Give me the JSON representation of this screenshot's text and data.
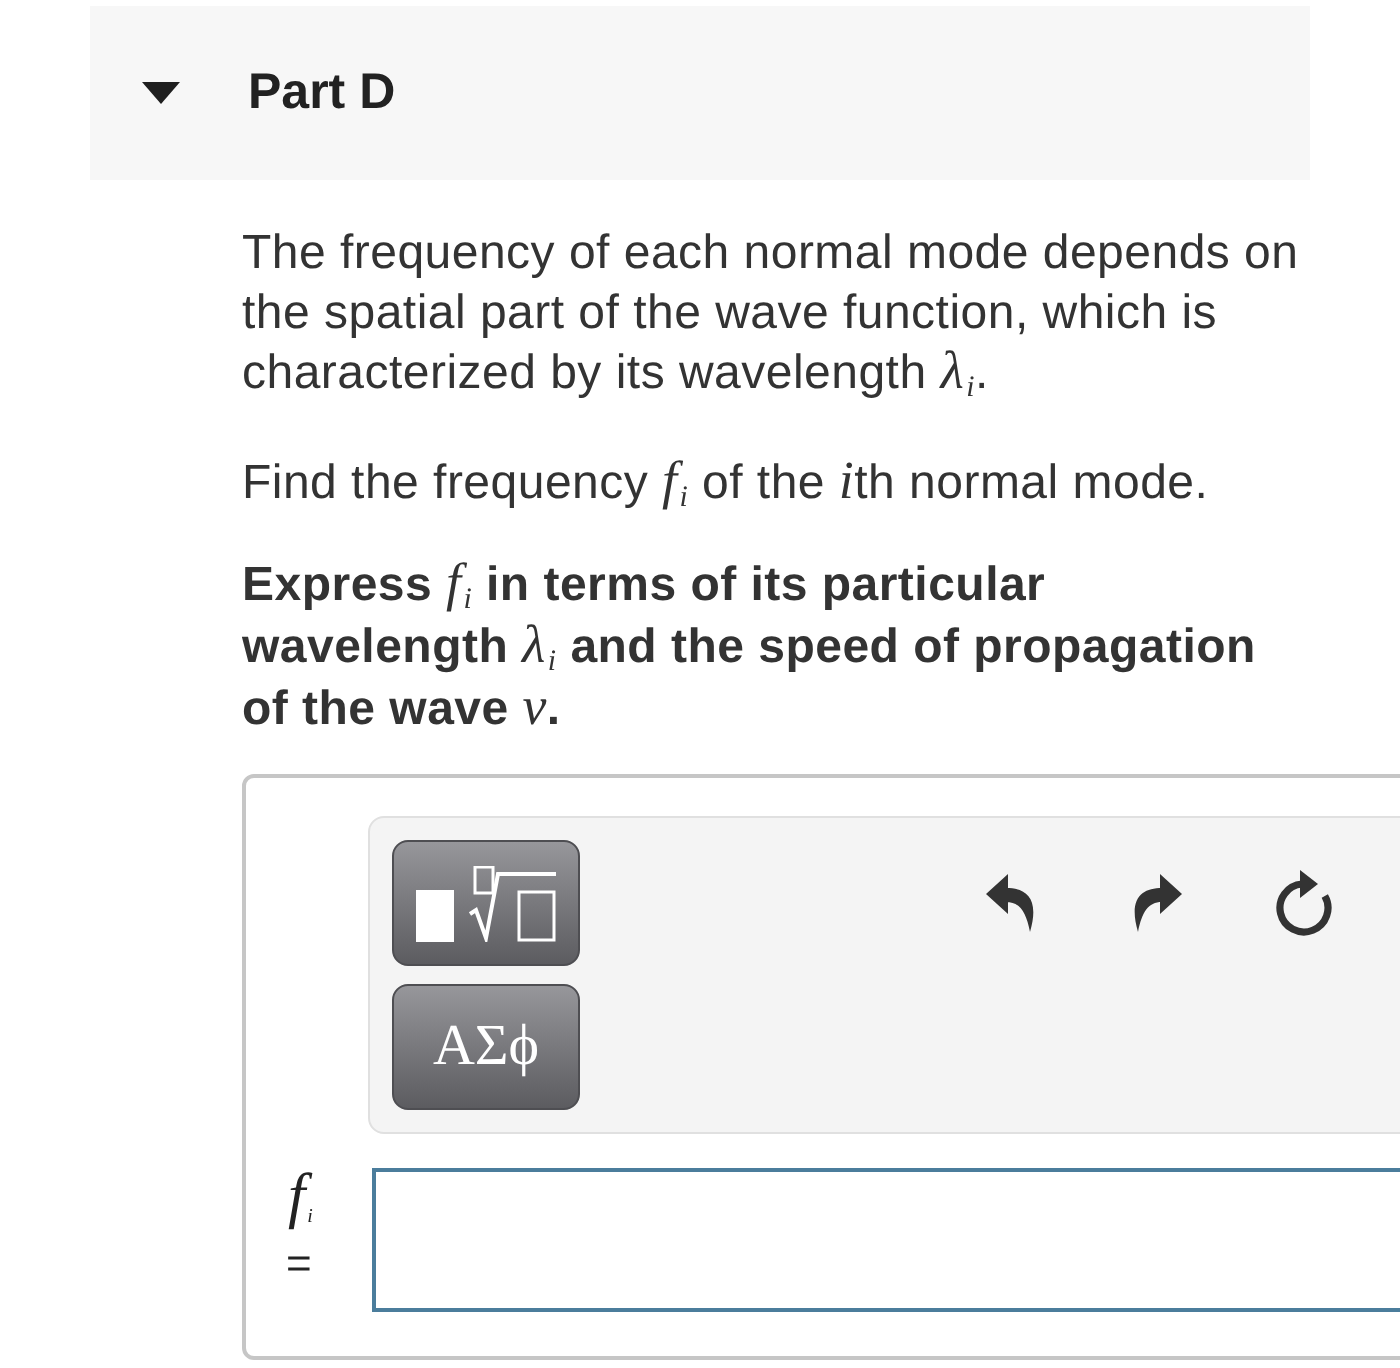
{
  "part": {
    "title": "Part D",
    "expanded": true
  },
  "question": [
    {
      "bold": false,
      "segments": [
        {
          "kind": "text",
          "text": "The frequency of each normal mode depends on the spatial part of the wave function, which is characterized by its wavelength "
        },
        {
          "kind": "math",
          "base": "λ",
          "sub": "i"
        },
        {
          "kind": "text",
          "text": "."
        }
      ]
    },
    {
      "bold": false,
      "segments": [
        {
          "kind": "text",
          "text": "Find the frequency "
        },
        {
          "kind": "math",
          "base": "f",
          "sub": "i"
        },
        {
          "kind": "text",
          "text": " of the "
        },
        {
          "kind": "math",
          "base": "i"
        },
        {
          "kind": "text",
          "text": "th normal mode."
        }
      ]
    },
    {
      "bold": true,
      "segments": [
        {
          "kind": "text",
          "text": "Express "
        },
        {
          "kind": "math",
          "base": "f",
          "sub": "i"
        },
        {
          "kind": "text",
          "text": " in terms of its particular wavelength "
        },
        {
          "kind": "math",
          "base": "λ",
          "sub": "i"
        },
        {
          "kind": "text",
          "text": " and the speed of propagation of the wave "
        },
        {
          "kind": "math",
          "base": "v"
        },
        {
          "kind": "text",
          "text": "."
        }
      ]
    }
  ],
  "answer": {
    "toolbar": {
      "palettes": [
        {
          "kind": "templates"
        },
        {
          "kind": "symbols",
          "label": "ΑΣϕ"
        }
      ],
      "actions": [
        {
          "kind": "undo"
        },
        {
          "kind": "redo"
        },
        {
          "kind": "reset"
        }
      ]
    },
    "label": {
      "base": "f",
      "sub": "i",
      "sign": "="
    }
  }
}
